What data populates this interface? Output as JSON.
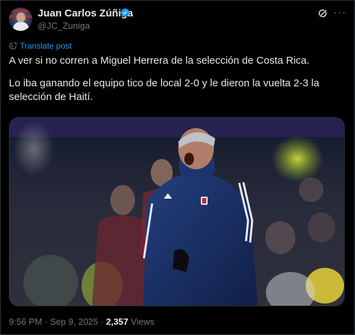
{
  "author": {
    "name": "Juan Carlos Zúñiga",
    "handle": "@JC_Zuniga",
    "verified": true,
    "verified_color": "#1d9bf0"
  },
  "actions": {
    "grok_icon": "grok-icon",
    "more_icon": "more-icon"
  },
  "translate_label": "Translate post",
  "post": {
    "paragraphs": [
      "A ver si no corren a Miguel Herrera de la selección de Costa Rica.",
      "Lo iba ganando el equipo tico de local 2-0 y le dieron la vuelta 2-3 la selección de Haití."
    ]
  },
  "media": {
    "type": "photo"
  },
  "meta": {
    "time": "9:56 PM",
    "separator": "·",
    "date": "Sep 9, 2025",
    "views_count": "2,357",
    "views_label": "Views"
  },
  "colors": {
    "background": "#000000",
    "text": "#e7e9ea",
    "secondary": "#71767b",
    "link": "#1d9bf0",
    "border": "#2f3336"
  }
}
